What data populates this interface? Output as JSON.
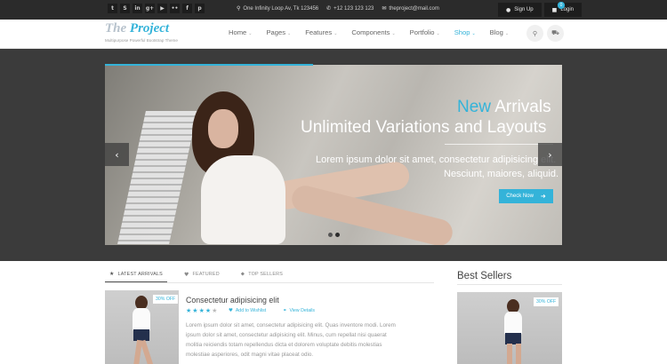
{
  "topbar": {
    "social": [
      {
        "name": "twitter-icon",
        "glyph": "t"
      },
      {
        "name": "skype-icon",
        "glyph": "S"
      },
      {
        "name": "linkedin-icon",
        "glyph": "in"
      },
      {
        "name": "googleplus-icon",
        "glyph": "g+"
      },
      {
        "name": "youtube-icon",
        "glyph": "▶"
      },
      {
        "name": "flickr-icon",
        "glyph": "••"
      },
      {
        "name": "facebook-icon",
        "glyph": "f"
      },
      {
        "name": "pinterest-icon",
        "glyph": "p"
      }
    ],
    "address": "One Infinity Loop Av, Tk 123456",
    "phone": "+12 123 123 123",
    "email": "theproject@mail.com",
    "signup_label": "Sign Up",
    "login_label": "Login"
  },
  "header": {
    "logo_part1": "The ",
    "logo_part2": "Project",
    "tagline": "Multipurpose Powerful Bootstrap Theme",
    "nav": [
      "Home",
      "Pages",
      "Features",
      "Components",
      "Portfolio",
      "Shop",
      "Blog"
    ],
    "active_nav": "Shop",
    "cart_count": "0"
  },
  "slider": {
    "title_accent": "New",
    "title_rest": " Arrivals",
    "title_line2": "Unlimited Variations and Layouts",
    "text_line1": "Lorem ipsum dolor sit amet, consectetur adipisicing elit.",
    "text_line2": "Nesciunt, maiores, aliquid.",
    "button_label": "Check Now",
    "prev_icon": "‹",
    "next_icon": "›"
  },
  "tabs": [
    {
      "label": "LATEST ARRIVALS",
      "icon": "star-icon",
      "glyph": "★",
      "active": true
    },
    {
      "label": "FEATURED",
      "icon": "heart-icon",
      "glyph": "♥",
      "active": false
    },
    {
      "label": "TOP SELLERS",
      "icon": "tag-icon",
      "glyph": "⬥",
      "active": false
    }
  ],
  "product": {
    "sale_badge": "30% OFF",
    "title": "Consectetur adipisicing elit",
    "rating": 4,
    "rating_max": 5,
    "wishlist_label": "Add to Wishlist",
    "details_label": "View Details",
    "description": "Lorem ipsum dolor sit amet, consectetur adipisicing elit. Quas inventore modi. Lorem ipsum dolor sit amet, consectetur adipisicing elit. Minus, cum repellat nisi quaerat molitia reiciendis totam repellendus dicta et dolorem voluptate debitis molestias molestiae asperiores, odit magni vitae placeat odio."
  },
  "best_sellers": {
    "title": "Best Sellers",
    "sale_badge": "30% OFF"
  },
  "colors": {
    "accent": "#34b3d9",
    "topbar_bg": "#2b2b2b",
    "hero_bg": "#3b3b3b"
  }
}
